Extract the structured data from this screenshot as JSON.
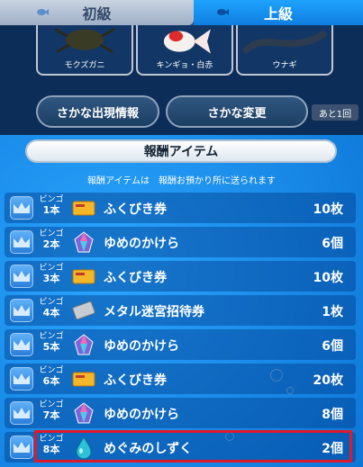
{
  "tabs": {
    "beginner": "初級",
    "advanced": "上級"
  },
  "fish": [
    {
      "name": "モクズガニ"
    },
    {
      "name": "キンギョ・白赤"
    },
    {
      "name": "ウナギ"
    }
  ],
  "buttons": {
    "appearance_info": "さかな出現情報",
    "change_fish": "さかな変更",
    "remaining": "あと1回"
  },
  "rewards": {
    "title": "報酬アイテム",
    "note": "報酬アイテムは　報酬お預かり所に送られます",
    "rows": [
      {
        "bingo_label": "ビンゴ",
        "bingo_count": "1本",
        "item": "ふくびき券",
        "qty": "10枚",
        "icon": "ticket-icon"
      },
      {
        "bingo_label": "ビンゴ",
        "bingo_count": "2本",
        "item": "ゆめのかけら",
        "qty": "6個",
        "icon": "crystal-icon"
      },
      {
        "bingo_label": "ビンゴ",
        "bingo_count": "3本",
        "item": "ふくびき券",
        "qty": "10枚",
        "icon": "ticket-icon"
      },
      {
        "bingo_label": "ビンゴ",
        "bingo_count": "4本",
        "item": "メタル迷宮招待券",
        "qty": "1枚",
        "icon": "metal-ticket-icon"
      },
      {
        "bingo_label": "ビンゴ",
        "bingo_count": "5本",
        "item": "ゆめのかけら",
        "qty": "6個",
        "icon": "crystal-icon"
      },
      {
        "bingo_label": "ビンゴ",
        "bingo_count": "6本",
        "item": "ふくびき券",
        "qty": "20枚",
        "icon": "ticket-icon"
      },
      {
        "bingo_label": "ビンゴ",
        "bingo_count": "7本",
        "item": "ゆめのかけら",
        "qty": "8個",
        "icon": "crystal-icon"
      },
      {
        "bingo_label": "ビンゴ",
        "bingo_count": "8本",
        "item": "めぐみのしずく",
        "qty": "2個",
        "icon": "water-drop-icon"
      }
    ]
  },
  "colors": {
    "highlight": "#e0192a",
    "accent_blue": "#1a8be6"
  }
}
